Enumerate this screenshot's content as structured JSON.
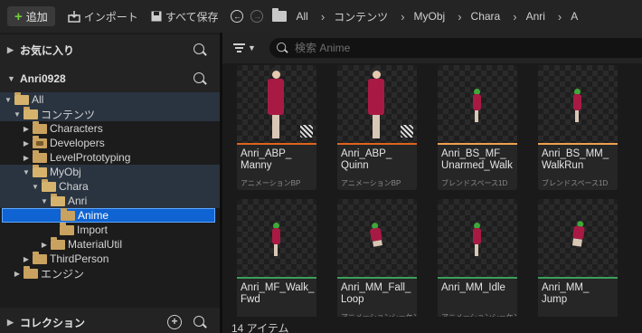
{
  "toolbar": {
    "add_label": "追加",
    "import_label": "インポート",
    "save_all_label": "すべて保存",
    "breadcrumbs": [
      "All",
      "コンテンツ",
      "MyObj",
      "Chara",
      "Anri",
      "A"
    ]
  },
  "sidebar": {
    "favorites_label": "お気に入り",
    "project_label": "Anri0928",
    "collections_label": "コレクション",
    "tree": [
      {
        "label": "All"
      },
      {
        "label": "コンテンツ"
      },
      {
        "label": "Characters"
      },
      {
        "label": "Developers"
      },
      {
        "label": "LevelPrototyping"
      },
      {
        "label": "MyObj"
      },
      {
        "label": "Chara"
      },
      {
        "label": "Anri"
      },
      {
        "label": "Anime"
      },
      {
        "label": "Import"
      },
      {
        "label": "MaterialUtil"
      },
      {
        "label": "ThirdPerson"
      },
      {
        "label": "エンジン"
      }
    ]
  },
  "search": {
    "placeholder": "検索 Anime"
  },
  "assets": [
    {
      "name": "Anri_ABP_\nManny",
      "type": "アニメーションBP",
      "bar_color": "#e0631c"
    },
    {
      "name": "Anri_ABP_\nQuinn",
      "type": "アニメーションBP",
      "bar_color": "#e0631c"
    },
    {
      "name": "Anri_BS_MF_\nUnarmed_Walk",
      "type": "ブレンドスペース1D",
      "bar_color": "#f0a050"
    },
    {
      "name": "Anri_BS_MM_\nWalkRun",
      "type": "ブレンドスペース1D",
      "bar_color": "#f0a050"
    },
    {
      "name": "Anri_MF_Walk_\nFwd",
      "type": "",
      "bar_color": "#3aa05a"
    },
    {
      "name": "Anri_MM_Fall_\nLoop",
      "type": "アニメーションシーケンス",
      "bar_color": "#3aa05a"
    },
    {
      "name": "Anri_MM_Idle",
      "type": "アニメーションシーケンス",
      "bar_color": "#3aa05a"
    },
    {
      "name": "Anri_MM_\nJump",
      "type": "",
      "bar_color": "#3aa05a"
    }
  ],
  "status": {
    "item_count": "14 アイテム"
  }
}
